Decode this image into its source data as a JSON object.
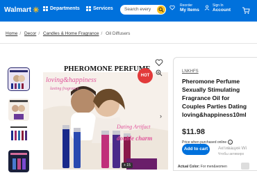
{
  "header": {
    "logo": "Walmart",
    "departments": "Departments",
    "services": "Services",
    "search_placeholder": "Search every",
    "reorder_small": "Reorder",
    "reorder_big": "My Items",
    "signin_small": "Sign In",
    "signin_big": "Account"
  },
  "breadcrumb": {
    "items": [
      "Home",
      "Decor",
      "Candles & Home Fragrance",
      "Oil Diffusers"
    ]
  },
  "gallery": {
    "headline": "PHEROMONE PERFUME",
    "badge": "HOT",
    "script1": "loving&happiness",
    "script2": "lasting fragrance",
    "script3": "Dating Artifact",
    "script4": "double charm",
    "count": "+ 15"
  },
  "product": {
    "brand": "LNKHFS",
    "title": "Pheromone Perfume Sexually Stimulating Fragrance Oil for Couples Parties Dating loving&happiness10ml",
    "price": "$11.98",
    "price_note": "Price when purchased online",
    "add_to_cart": "Add to cart",
    "actual_color_label": "Actual Color:",
    "actual_color_value": "For men&women"
  },
  "overlay": {
    "activate": "Активация Wi",
    "activate_sub": "Чтобы активиро"
  },
  "colors": {
    "brand_blue": "#0071dc",
    "spark_yellow": "#ffc220"
  }
}
